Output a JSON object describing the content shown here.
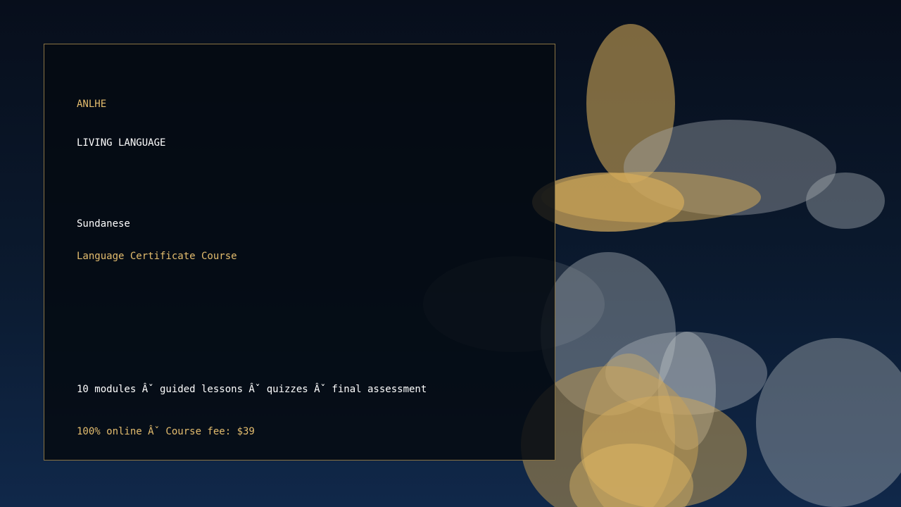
{
  "brand": "ANLHE",
  "tagline": "LIVING LANGUAGE",
  "language": "Sundanese",
  "course_title": "Language Certificate Course",
  "course_details": "10 modules Âˇ guided lessons Âˇ quizzes Âˇ final assessment",
  "course_fee_line": "100% online Âˇ Course fee: $39",
  "colors": {
    "accent_gold": "#e4bd6e",
    "text_white": "#ffffff",
    "card_border": "#8a7444",
    "background_top": "#070e1b",
    "background_bottom": "#10284a"
  }
}
